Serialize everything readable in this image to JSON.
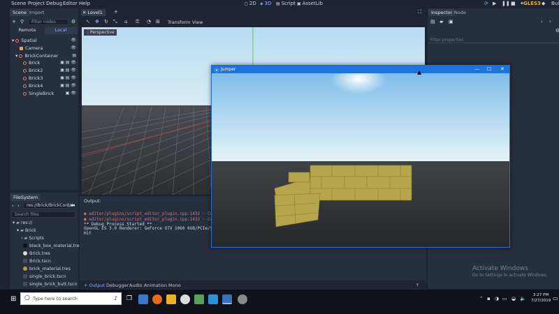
{
  "menu": [
    "Scene",
    "Project",
    "Debug",
    "Editor",
    "Help"
  ],
  "workspaces": {
    "two_d": "2D",
    "three_d": "3D",
    "script": "Script",
    "assetlib": "AssetLib"
  },
  "renderer": "GLES3",
  "renderer_suffix": "Bui",
  "scene_dock": {
    "tabs": [
      "Scene",
      "Import"
    ],
    "filter_placeholder": "Filter nodes",
    "remote": "Remote",
    "local": "Local",
    "tree": [
      {
        "label": "Spatial"
      },
      {
        "label": "Camera"
      },
      {
        "label": "BrickContainer"
      },
      {
        "label": "Brick"
      },
      {
        "label": "Brick2"
      },
      {
        "label": "Brick3"
      },
      {
        "label": "Brick4"
      },
      {
        "label": "SingleBrick"
      }
    ]
  },
  "editor_tabs": {
    "level": "Level1"
  },
  "viewport_toolbar": {
    "transform": "Transform",
    "view": "View",
    "perspective": "Perspective"
  },
  "filesystem": {
    "tab": "FileSystem",
    "path": "res://Brick/BrickContai",
    "search_placeholder": "Search files",
    "items": [
      {
        "label": "res://"
      },
      {
        "label": "Brick"
      },
      {
        "label": "Scripts"
      },
      {
        "label": "black_box_material.tres"
      },
      {
        "label": "Brick.tres"
      },
      {
        "label": "Brick.tscn"
      },
      {
        "label": "brick_material.tres"
      },
      {
        "label": "single_brick.tscn"
      },
      {
        "label": "single_brick_butt.tscn"
      }
    ]
  },
  "output": {
    "title": "Output:",
    "lines": [
      {
        "text": "● editor/plugins/script_editor_plugin.cpp:1432 - Condit",
        "color": "#e0736b"
      },
      {
        "text": "● editor/plugins/script_editor_plugin.cpp:1432 - Condit",
        "color": "#e0736b"
      },
      {
        "text": "** Debug Process Started **",
        "color": "#d0d6df"
      },
      {
        "text": "OpenGL ES 3.0 Renderer: GeForce GTX 1060 6GB/PCIe/SSE2",
        "color": "#d0d6df"
      },
      {
        "text": "Hit",
        "color": "#d0d6df"
      }
    ],
    "bottom_tabs": [
      "+ Output",
      "Debugger",
      "Audio",
      "Animation",
      "Mono"
    ]
  },
  "inspector": {
    "tabs": [
      "Inspector",
      "Node"
    ],
    "filter_placeholder": "Filter properties"
  },
  "game_window": {
    "title": "Jumper"
  },
  "activation": {
    "title": "Activate Windows",
    "subtitle": "Go to Settings to activate Windows."
  },
  "taskbar": {
    "search_placeholder": "Type here to search",
    "time": "3:27 PM",
    "date": "7/27/2019"
  }
}
